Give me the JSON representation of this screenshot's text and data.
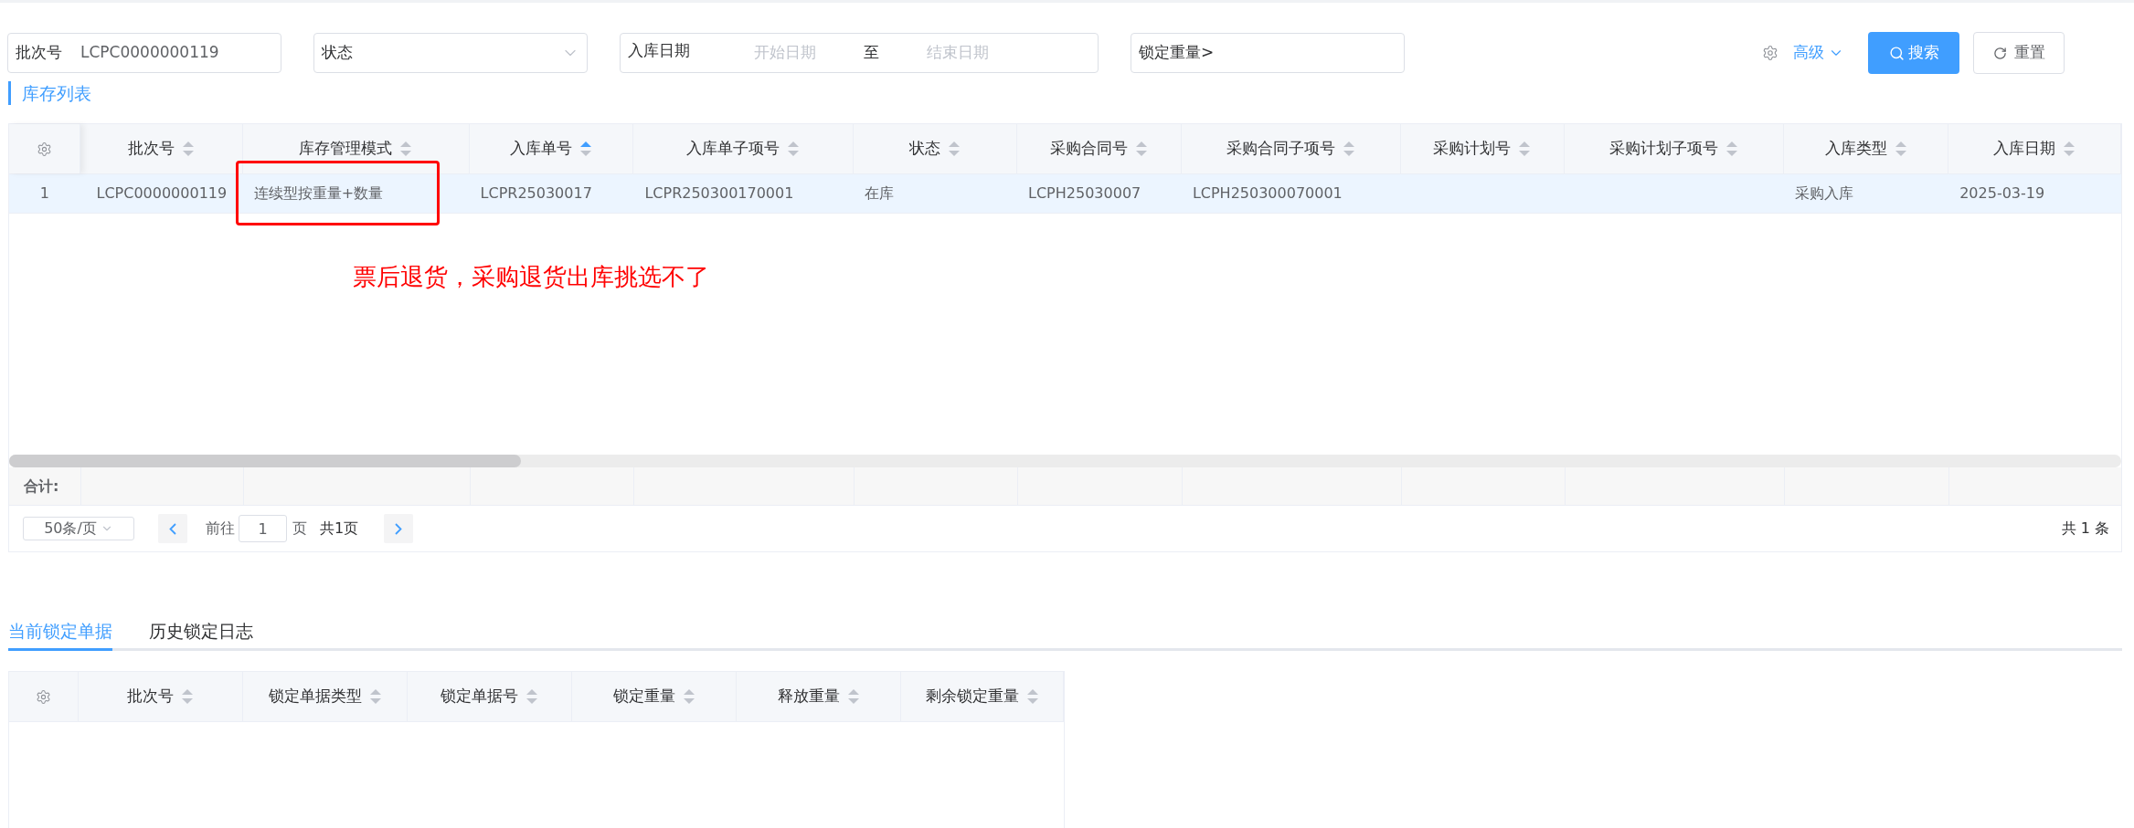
{
  "filters": [
    {
      "kind": "text",
      "label": "批次号",
      "value": "LCPC0000000119"
    },
    {
      "kind": "select",
      "placeholder": "状态"
    },
    {
      "kind": "daterange",
      "label": "入库日期",
      "start_placeholder": "开始日期",
      "separator": "至",
      "end_placeholder": "结束日期"
    },
    {
      "kind": "text",
      "label": "锁定重量>"
    }
  ],
  "actions": {
    "advanced": "高级",
    "search": "搜索",
    "reset": "重置"
  },
  "section_title": "库存列表",
  "table": {
    "columns": [
      {
        "label": "批次号",
        "sorted_ascending": false
      },
      {
        "label": "库存管理模式",
        "sorted_ascending": false
      },
      {
        "label": "入库单号",
        "sorted_ascending": true
      },
      {
        "label": "入库单子项号",
        "sorted_ascending": false
      },
      {
        "label": "状态",
        "sorted_ascending": false
      },
      {
        "label": "采购合同号",
        "sorted_ascending": false
      },
      {
        "label": "采购合同子项号",
        "sorted_ascending": false
      },
      {
        "label": "采购计划号",
        "sorted_ascending": false
      },
      {
        "label": "采购计划子项号",
        "sorted_ascending": false
      },
      {
        "label": "入库类型",
        "sorted_ascending": false
      },
      {
        "label": "入库日期",
        "sorted_ascending": false
      }
    ],
    "rows": [
      {
        "index": "1",
        "selected": true,
        "cells": [
          "LCPC0000000119",
          "连续型按重量+数量",
          "LCPR25030017",
          "LCPR250300170001",
          "在库",
          "LCPH25030007",
          "LCPH250300070001",
          null,
          null,
          "采购入库",
          "2025-03-19"
        ]
      }
    ],
    "total_label": "合计:"
  },
  "annotation": {
    "text": "票后退货，采购退货出库挑选不了"
  },
  "pagination": {
    "page_size": "50条/页",
    "goto_label": "前往",
    "page": "1",
    "page_unit": "页",
    "pages": "共1页",
    "total": "共 1 条"
  },
  "tabs": [
    {
      "label": "当前锁定单据",
      "selected": true
    },
    {
      "label": "历史锁定日志",
      "selected": false
    }
  ],
  "lock_table": {
    "columns": [
      {
        "label": "批次号",
        "sorted_ascending": false
      },
      {
        "label": "锁定单据类型",
        "sorted_ascending": false
      },
      {
        "label": "锁定单据号",
        "sorted_ascending": false
      },
      {
        "label": "锁定重量",
        "sorted_ascending": false
      },
      {
        "label": "释放重量",
        "sorted_ascending": false
      },
      {
        "label": "剩余锁定重量",
        "sorted_ascending": false
      }
    ]
  }
}
